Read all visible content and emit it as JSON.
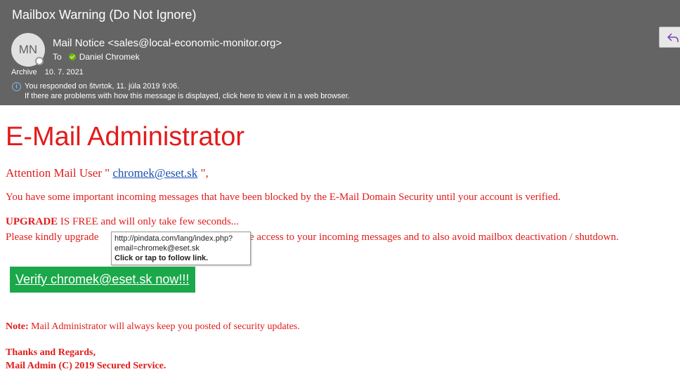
{
  "header": {
    "subject": "Mailbox Warning (Do Not Ignore)",
    "avatar_initials": "MN",
    "sender": "Mail Notice <sales@local-economic-monitor.org>",
    "to_label": "To",
    "recipient": "Daniel Chromek",
    "folder": "Archive",
    "date": "10. 7. 2021",
    "info_line1": "You responded  on štvrtok, 11. júla 2019 9:06.",
    "info_line2": "If there are problems with how this message is displayed, click here to view it in a web browser."
  },
  "body": {
    "title": "E-Mail Administrator",
    "attention_prefix": "Attention Mail User \" ",
    "attention_email": "chromek@eset.sk",
    "attention_suffix": " \",",
    "para1": "You have some important incoming messages that have been blocked by the E-Mail Domain Security until your account is verified.",
    "upgrade_bold": "UPGRADE",
    "upgrade_rest": " IS FREE and will only take few seconds...",
    "para3_left": "Please kindly upgrade",
    "para3_right": "e access to your incoming messages and to also avoid mailbox deactivation / shutdown.",
    "verify_button": "Verify chromek@eset.sk now!!!",
    "note_label": "Note:",
    "note_text": "  Mail Administrator will always keep you posted of security updates.",
    "thanks": "Thanks and Regards,",
    "signature": "Mail Admin (C) 2019 Secured Service."
  },
  "tooltip": {
    "url": "http://pindata.com/lang/index.php?",
    "param": "email=chromek@eset.sk",
    "hint": "Click or tap to follow link."
  },
  "colors": {
    "header_bg": "#646464",
    "body_text": "#e21b1b",
    "link": "#1a4fb5",
    "button_bg": "#1ba84a"
  }
}
